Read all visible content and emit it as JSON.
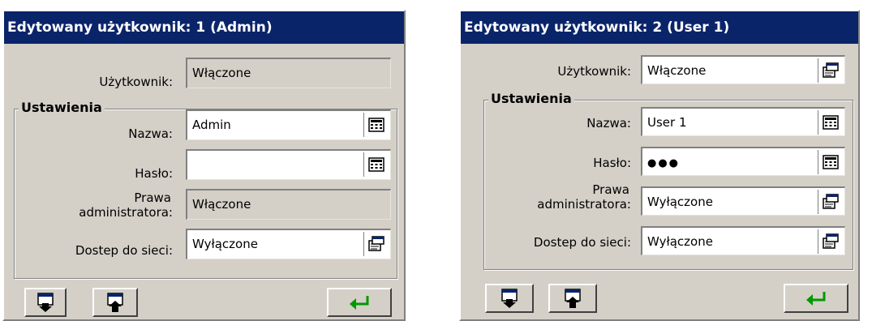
{
  "left_panel": {
    "title": "Edytowany użytkownik: 1 (Admin)",
    "user_label": "Użytkownik:",
    "user_value": "Włączone",
    "group_label": "Ustawienia",
    "name_label": "Nazwa:",
    "name_value": "Admin",
    "password_label": "Hasło:",
    "password_value": "",
    "admin_label_line1": "Prawa",
    "admin_label_line2": "administratora:",
    "admin_value": "Włączone",
    "network_label": "Dostep do sieci:",
    "network_value": "Wyłączone"
  },
  "right_panel": {
    "title": "Edytowany użytkownik: 2 (User 1)",
    "user_label": "Użytkownik:",
    "user_value": "Włączone",
    "group_label": "Ustawienia",
    "name_label": "Nazwa:",
    "name_value": "User 1",
    "password_label": "Hasło:",
    "password_value": "●●●",
    "admin_label_line1": "Prawa",
    "admin_label_line2": "administratora:",
    "admin_value": "Wyłączone",
    "network_label": "Dostep do sieci:",
    "network_value": "Wyłączone"
  },
  "icons": {
    "keyboard": "keyboard-icon",
    "dropdown": "list-select-icon",
    "import": "import-down-icon",
    "export": "export-up-icon",
    "enter": "enter-arrow-icon"
  },
  "colors": {
    "titlebar": "#0a246a",
    "panel": "#d4d0c8",
    "enter_arrow": "#009900"
  }
}
